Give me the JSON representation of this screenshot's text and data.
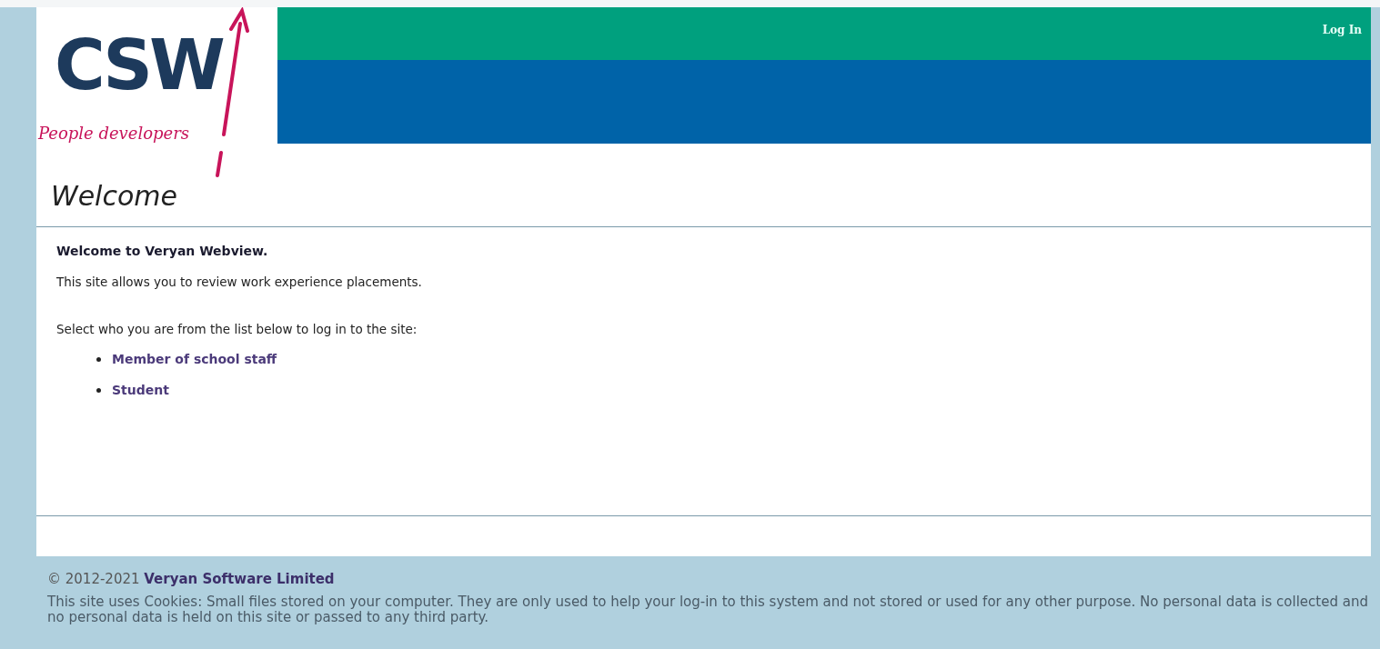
{
  "header": {
    "logo": {
      "wordmark": "CSW",
      "tagline": "People developers"
    },
    "login_link": "Log In"
  },
  "page_title": "Welcome",
  "content": {
    "heading": "Welcome to Veryan Webview.",
    "intro": "This site allows you to review work experience placements.",
    "prompt": "Select who you are from the list below to log in to the site:",
    "options": [
      {
        "label": "Member of school staff"
      },
      {
        "label": "Student"
      }
    ]
  },
  "footer": {
    "copyright": "© 2012-2021",
    "company_link": "Veryan Software Limited",
    "cookie_notice": "This site uses Cookies: Small files stored on your computer. They are only used to help your log-in to this system and not stored or used for any other purpose. No personal data is collected and no personal data is held on this site or passed to any third party."
  }
}
